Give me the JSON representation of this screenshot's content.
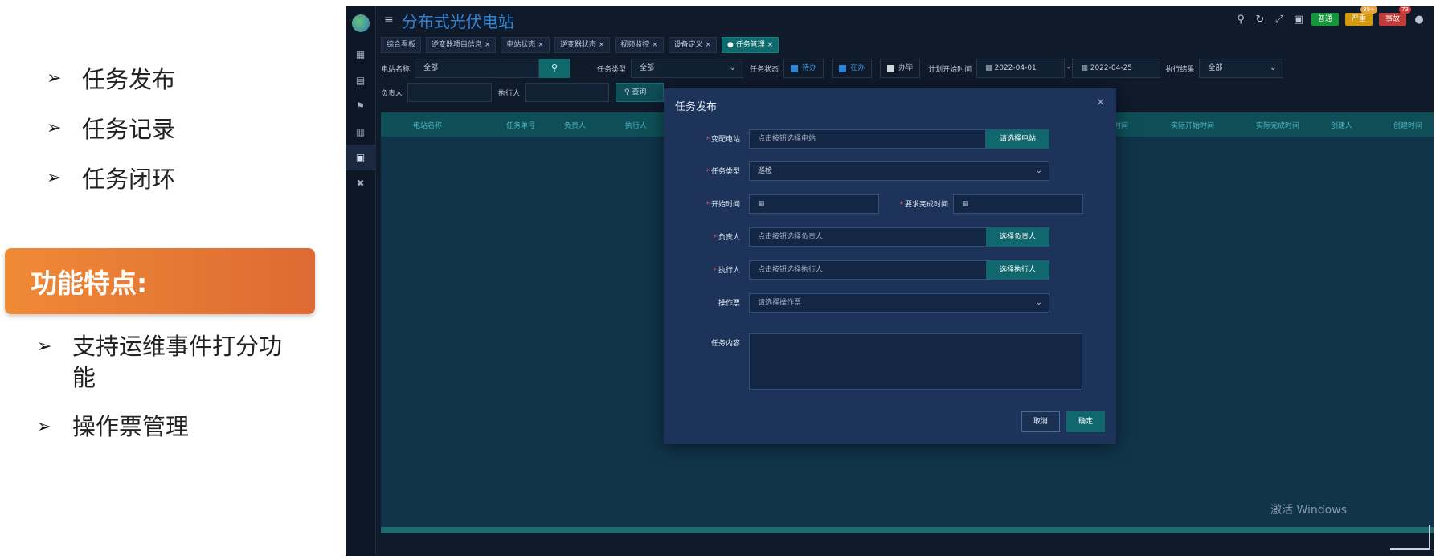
{
  "slide": {
    "bullets_top": [
      "任务发布",
      "任务记录",
      "任务闭环"
    ],
    "feature_title": "功能特点:",
    "bullets_bottom": [
      "支持运维事件打分功能",
      "操作票管理"
    ]
  },
  "app": {
    "title": "分布式光伏电站",
    "header_buttons": {
      "green": "普通",
      "orange": "严重",
      "orange_count": "89+",
      "red": "事故",
      "red_count": "73"
    },
    "tabs": [
      "综合看板",
      "逆变器项目信息 ×",
      "电站状态 ×",
      "逆变器状态 ×",
      "视频监控 ×",
      "设备定义 ×",
      "● 任务管理 ×"
    ],
    "filters": {
      "station_label": "电站名称",
      "station_value": "全部",
      "task_type_label": "任务类型",
      "task_type_value": "全部",
      "task_status_label": "任务状态",
      "status_todo": "待办",
      "status_doing": "在办",
      "status_done": "办毕",
      "plan_start_label": "计划开始时间",
      "date_from": "2022-04-01",
      "date_sep": "-",
      "date_to": "2022-04-25",
      "result_label": "执行结果",
      "result_value": "全部",
      "owner_label": "负责人",
      "executor_label": "执行人",
      "query_button": "查询"
    },
    "table_headers": {
      "station": "电站名称",
      "task_no": "任务单号",
      "owner": "负责人",
      "executor": "执行人",
      "plan_end": "时间",
      "actual_start": "实际开始时间",
      "actual_end": "实际完成时间",
      "creator": "创建人",
      "create_time": "创建时间"
    },
    "watermark": "激活 Windows"
  },
  "modal": {
    "title": "任务发布",
    "close": "×",
    "fields": {
      "station_label": "变配电站",
      "station_placeholder": "点击按钮选择电站",
      "station_button": "请选择电站",
      "task_type_label": "任务类型",
      "task_type_value": "巡检",
      "start_label": "开始时间",
      "due_label": "要求完成时间",
      "owner_label": "负责人",
      "owner_placeholder": "点击按钮选择负责人",
      "owner_button": "选择负责人",
      "executor_label": "执行人",
      "executor_placeholder": "点击按钮选择执行人",
      "executor_button": "选择执行人",
      "ticket_label": "操作票",
      "ticket_placeholder": "请选择操作票",
      "content_label": "任务内容"
    },
    "cancel": "取消",
    "confirm": "确定"
  }
}
